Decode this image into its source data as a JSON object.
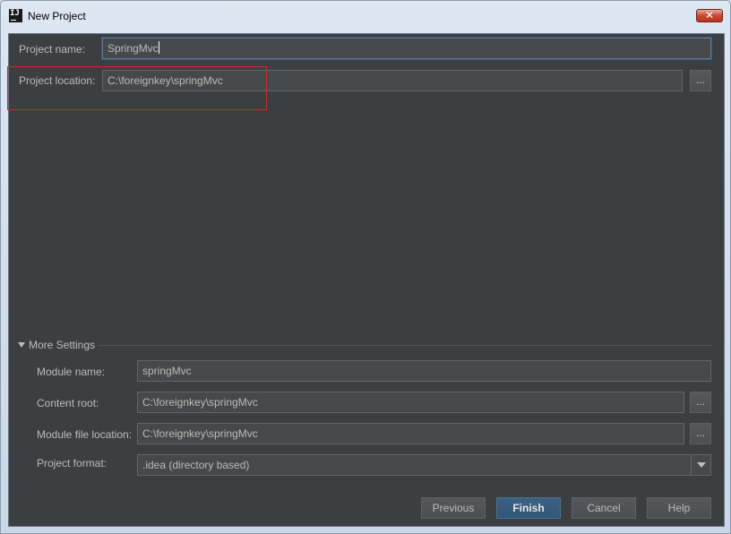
{
  "window": {
    "title": "New Project"
  },
  "form": {
    "project_name_label": "Project name:",
    "project_name_value": "SpringMvc",
    "project_location_label": "Project location:",
    "project_location_value": "C:\\foreignkey\\springMvc",
    "browse_label": "..."
  },
  "more_settings": {
    "label": "More Settings",
    "module_name_label": "Module name:",
    "module_name_value": "springMvc",
    "content_root_label": "Content root:",
    "content_root_value": "C:\\foreignkey\\springMvc",
    "module_file_location_label": "Module file location:",
    "module_file_location_value": "C:\\foreignkey\\springMvc",
    "project_format_label": "Project format:",
    "project_format_value": ".idea (directory based)"
  },
  "buttons": {
    "previous": "Previous",
    "finish": "Finish",
    "cancel": "Cancel",
    "help": "Help"
  },
  "colors": {
    "background": "#3c3f41",
    "field": "#45494a",
    "text": "#bbbbbb",
    "primary_button": "#365880",
    "highlight": "#cc2a2a"
  }
}
